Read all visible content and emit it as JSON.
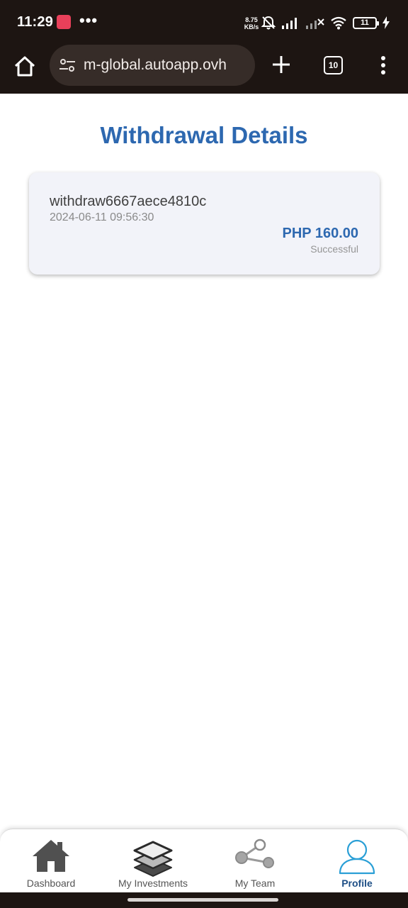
{
  "status_bar": {
    "time": "11:29",
    "dots": "•••",
    "speed_value": "8.75",
    "speed_unit": "KB/s",
    "battery": "11"
  },
  "browser": {
    "url": "m-global.autoapp.ovh",
    "tab_count": "10"
  },
  "page": {
    "title": "Withdrawal Details"
  },
  "withdrawals": [
    {
      "id": "withdraw6667aece4810c",
      "date": "2024-06-11 09:56:30",
      "amount": "PHP 160.00",
      "status": "Successful"
    }
  ],
  "nav": {
    "items": [
      {
        "label": "Dashboard",
        "icon": "home-icon"
      },
      {
        "label": "My Investments",
        "icon": "layers-icon"
      },
      {
        "label": "My Team",
        "icon": "share-icon"
      },
      {
        "label": "Profile",
        "icon": "user-icon"
      }
    ],
    "active": "Profile"
  },
  "colors": {
    "accent": "#2d68b0",
    "system_bar": "#1d1512",
    "profile_icon": "#2a9fd6"
  }
}
